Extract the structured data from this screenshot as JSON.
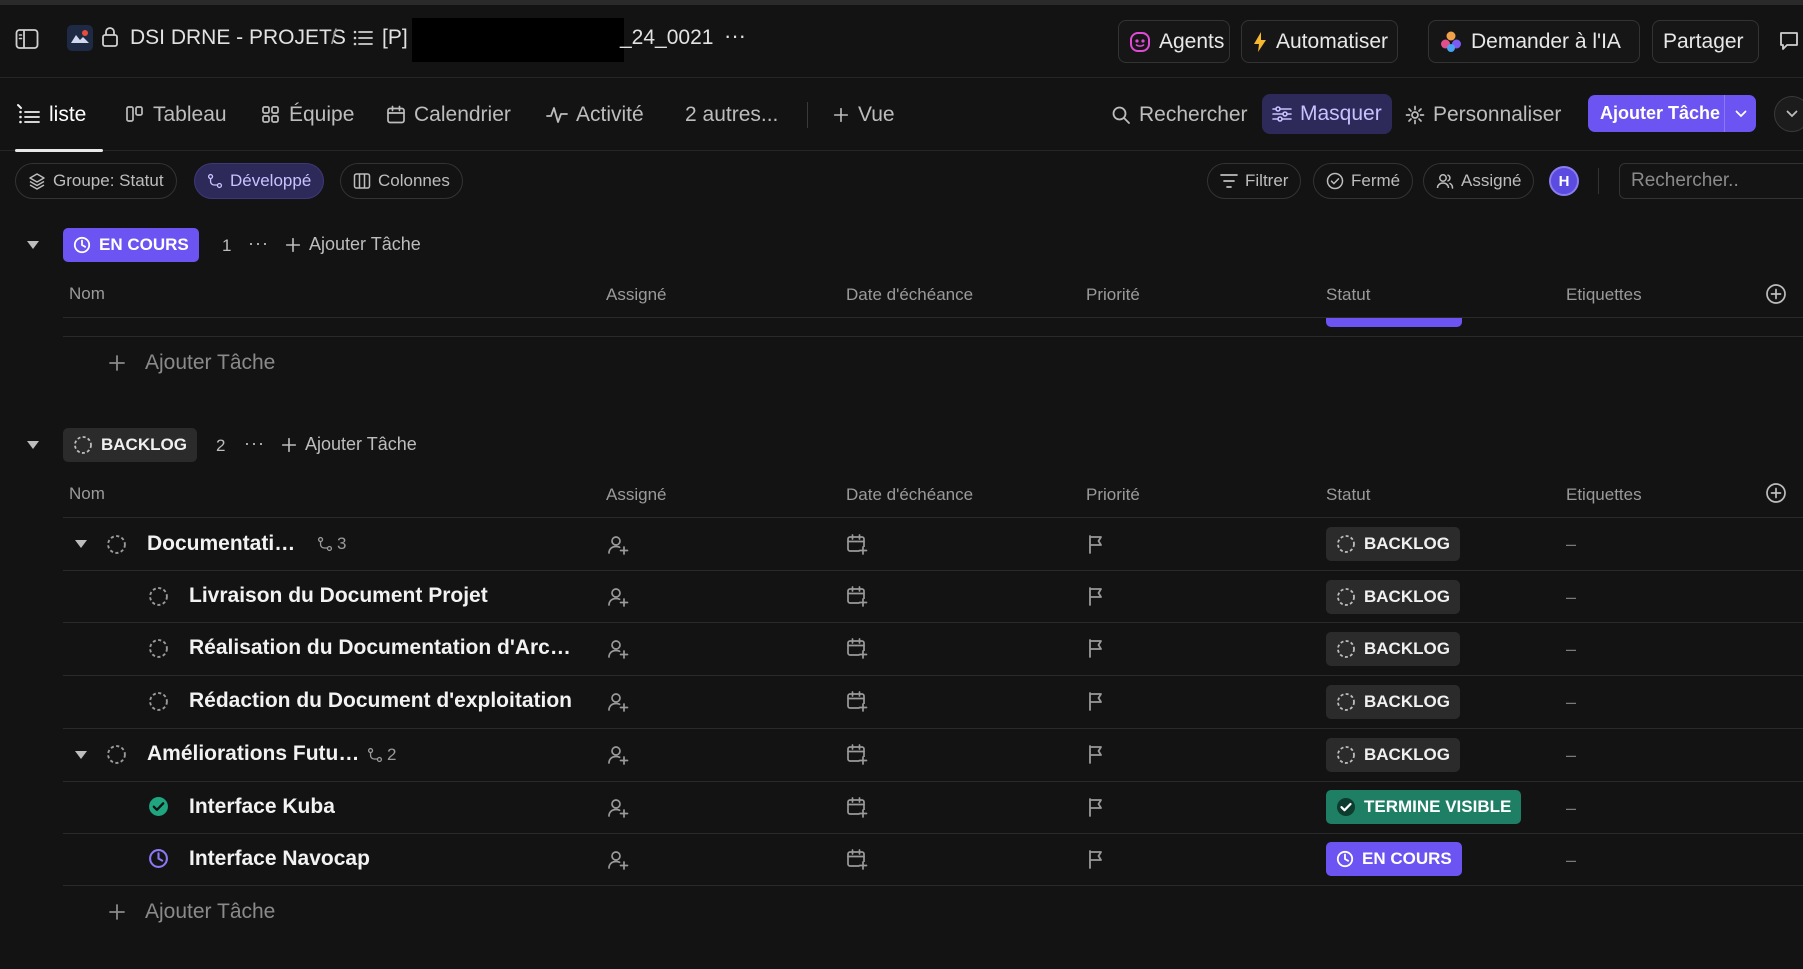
{
  "topbar": {
    "space_name": "DSI DRNE - PROJETS",
    "separator": "/",
    "list_prefix": "[P]",
    "list_suffix": "_24_0021",
    "more": "···",
    "agents_label": "Agents",
    "automate_label": "Automatiser",
    "ai_label": "Demander à l'IA",
    "share_label": "Partager"
  },
  "views": {
    "tabs": [
      {
        "label": "liste"
      },
      {
        "label": "Tableau"
      },
      {
        "label": "Équipe"
      },
      {
        "label": "Calendrier"
      },
      {
        "label": "Activité"
      },
      {
        "label": "2 autres..."
      }
    ],
    "add_view": "Vue",
    "search": "Rechercher",
    "hide": "Masquer",
    "customize": "Personnaliser",
    "add_task": "Ajouter Tâche"
  },
  "filters": {
    "group": "Groupe: Statut",
    "expanded": "Développé",
    "columns": "Colonnes",
    "filter": "Filtrer",
    "closed": "Fermé",
    "assigned": "Assigné",
    "avatar_initial": "H",
    "search_placeholder": "Rechercher.."
  },
  "columns": [
    "Nom",
    "Assigné",
    "Date d'échéance",
    "Priorité",
    "Statut",
    "Etiquettes"
  ],
  "add_task_label": "Ajouter Tâche",
  "empty_cell": "–",
  "colors": {
    "accent": "#6b54f2",
    "done": "#1f7f64",
    "backlog_badge": "#2b2b2b",
    "background": "#131313"
  },
  "groups": [
    {
      "status": "EN COURS",
      "count": "1"
    },
    {
      "status": "BACKLOG",
      "count": "2",
      "tasks": [
        {
          "name": "Documentations",
          "subtasks": "3",
          "status": "BACKLOG",
          "level": 0
        },
        {
          "name": "Livraison du Document Projet",
          "status": "BACKLOG",
          "level": 1
        },
        {
          "name": "Réalisation du Documentation d'Archit...",
          "status": "BACKLOG",
          "level": 1
        },
        {
          "name": "Rédaction du Document d'exploitation",
          "status": "BACKLOG",
          "level": 1
        },
        {
          "name": "Améliorations Futures",
          "subtasks": "2",
          "status": "BACKLOG",
          "level": 0
        },
        {
          "name": "Interface Kuba",
          "status": "TERMINE VISIBLE",
          "level": 1
        },
        {
          "name": "Interface Navocap",
          "status": "EN COURS",
          "level": 1
        }
      ]
    }
  ]
}
